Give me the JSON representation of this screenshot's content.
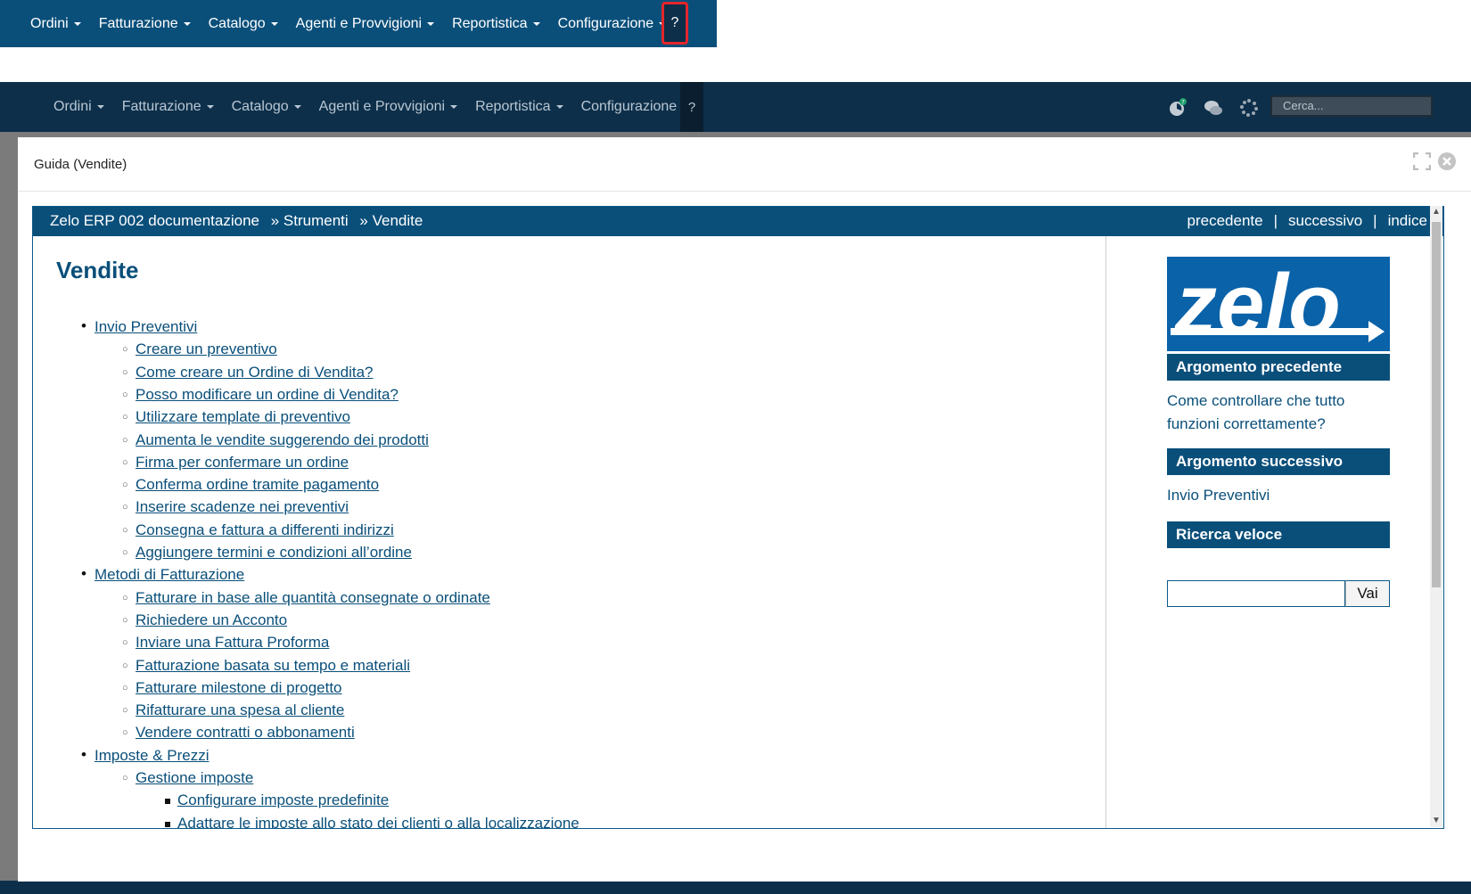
{
  "snippet_nav": {
    "items": [
      "Ordini",
      "Fatturazione",
      "Catalogo",
      "Agenti e Provvigioni",
      "Reportistica",
      "Configurazione"
    ],
    "help_label": "?"
  },
  "app_nav": {
    "items": [
      "Ordini",
      "Fatturazione",
      "Catalogo",
      "Agenti e Provvigioni",
      "Reportistica",
      "Configurazione"
    ],
    "help_label": "?",
    "search_placeholder": "Cerca...",
    "activity_badge": "7"
  },
  "modal": {
    "title": "Guida (Vendite)"
  },
  "doc": {
    "breadcrumb": [
      "Zelo ERP 002 documentazione",
      "» Strumenti",
      "» Vendite"
    ],
    "rel_links": [
      "precedente",
      "successivo",
      "indice"
    ],
    "heading": "Vendite",
    "toc": [
      {
        "level": 1,
        "text": "Invio Preventivi"
      },
      {
        "level": 2,
        "text": "Creare un preventivo"
      },
      {
        "level": 2,
        "text": "Come creare un Ordine di Vendita?"
      },
      {
        "level": 2,
        "text": "Posso modificare un ordine di Vendita?"
      },
      {
        "level": 2,
        "text": "Utilizzare template di preventivo"
      },
      {
        "level": 2,
        "text": "Aumenta le vendite suggerendo dei prodotti"
      },
      {
        "level": 2,
        "text": "Firma per confermare un ordine"
      },
      {
        "level": 2,
        "text": "Conferma ordine tramite pagamento"
      },
      {
        "level": 2,
        "text": "Inserire scadenze nei preventivi"
      },
      {
        "level": 2,
        "text": "Consegna e fattura a differenti indirizzi"
      },
      {
        "level": 2,
        "text": "Aggiungere termini e condizioni all’ordine"
      },
      {
        "level": 1,
        "text": "Metodi di Fatturazione"
      },
      {
        "level": 2,
        "text": "Fatturare in base alle quantità consegnate o ordinate"
      },
      {
        "level": 2,
        "text": "Richiedere un Acconto"
      },
      {
        "level": 2,
        "text": "Inviare una Fattura Proforma"
      },
      {
        "level": 2,
        "text": "Fatturazione basata su tempo e materiali"
      },
      {
        "level": 2,
        "text": "Fatturare milestone di progetto"
      },
      {
        "level": 2,
        "text": "Rifatturare una spesa al cliente"
      },
      {
        "level": 2,
        "text": "Vendere contratti o abbonamenti"
      },
      {
        "level": 1,
        "text": "Imposte & Prezzi"
      },
      {
        "level": 2,
        "text": "Gestione imposte"
      },
      {
        "level": 3,
        "text": "Configurare imposte predefinite"
      },
      {
        "level": 3,
        "text": "Adattare le imposte allo stato dei clienti o alla localizzazione"
      }
    ],
    "sidebar": {
      "logo_text": "zelo",
      "prev_heading": "Argomento precedente",
      "prev_link": "Come controllare che tutto funzioni correttamente?",
      "next_heading": "Argomento successivo",
      "next_link": "Invio Preventivi",
      "search_heading": "Ricerca veloce",
      "search_button": "Vai"
    }
  },
  "colors": {
    "primary": "#0a4f7a",
    "app_nav_bg": "#0d2f4a",
    "highlight_border": "#e4262b",
    "logo_bg": "#0a62a8"
  }
}
